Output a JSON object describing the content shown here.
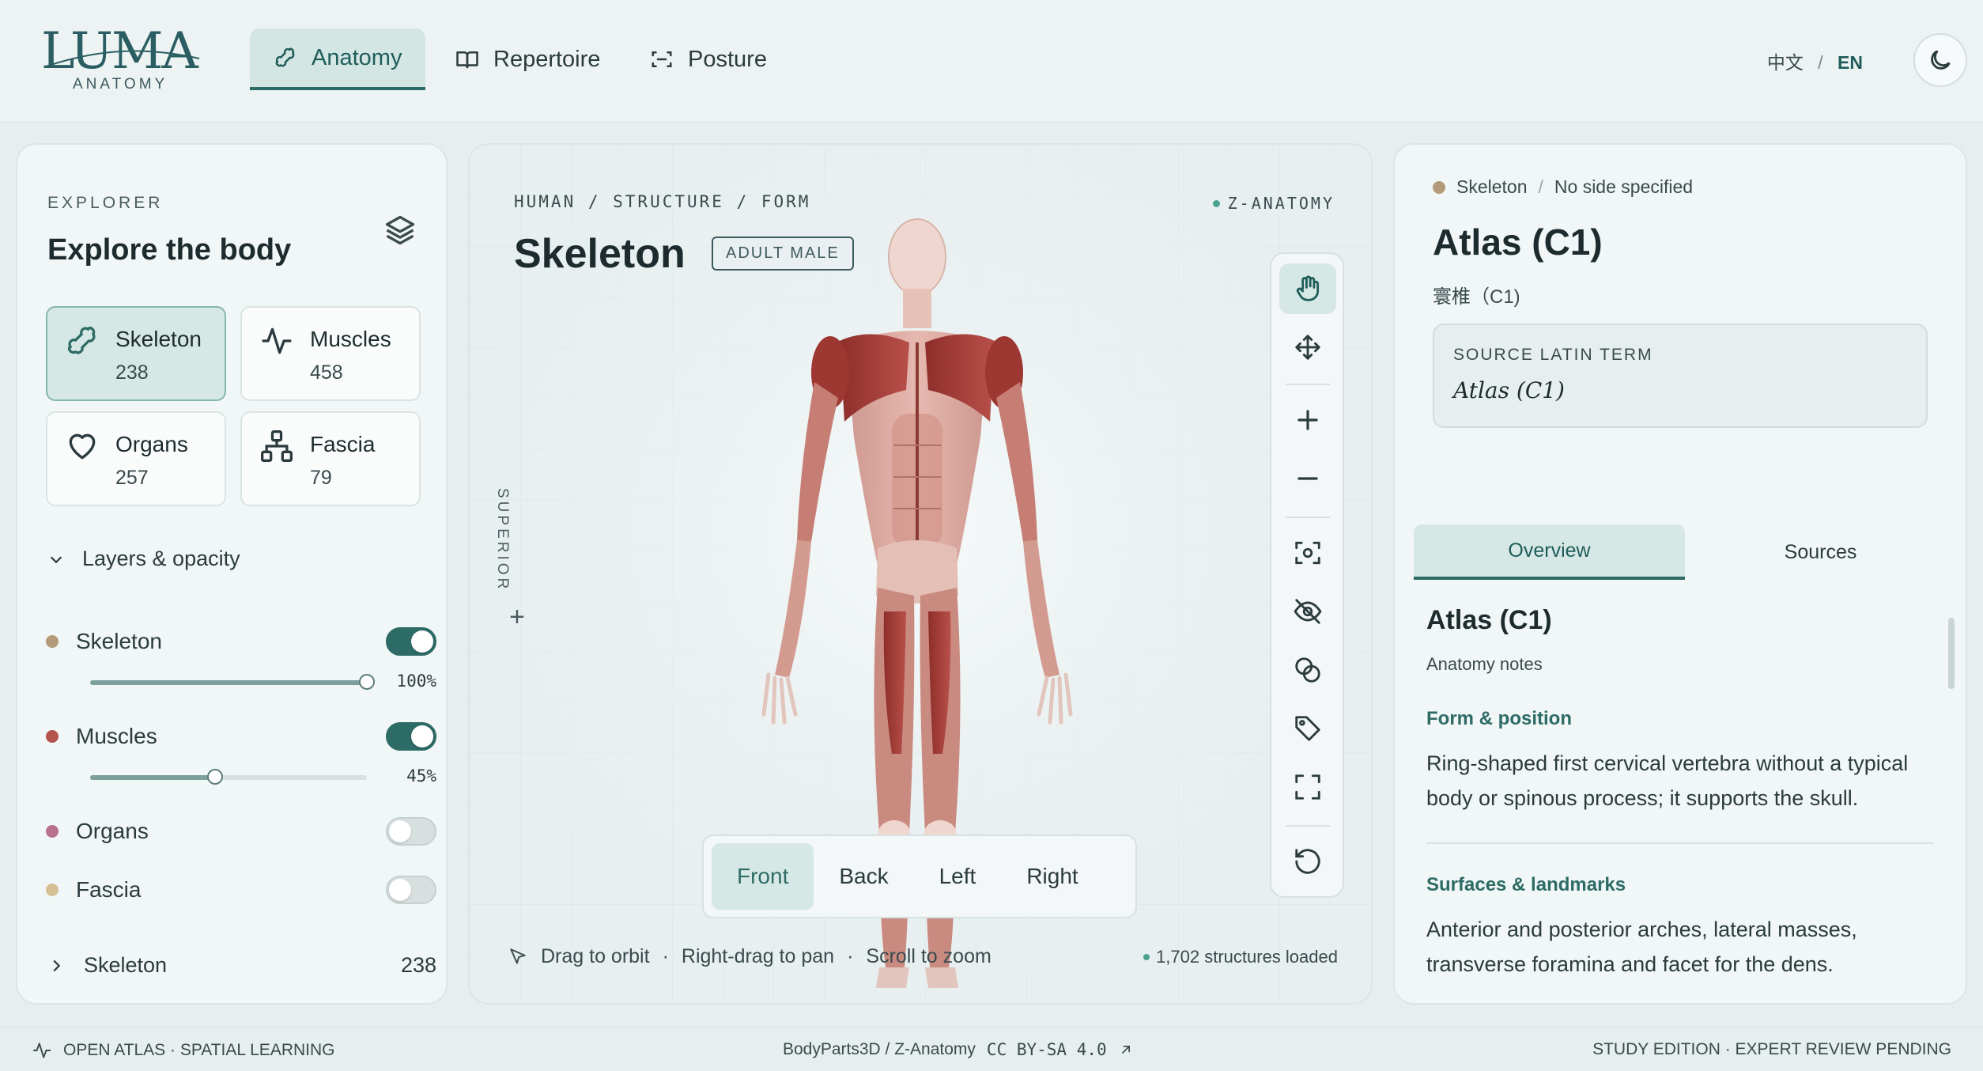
{
  "brand": {
    "wordmark": "LUMA",
    "sub": "ANATOMY"
  },
  "nav": {
    "tabs": [
      {
        "label": "Anatomy",
        "icon": "bone-icon",
        "active": true
      },
      {
        "label": "Repertoire",
        "icon": "book-icon",
        "active": false
      },
      {
        "label": "Posture",
        "icon": "scan-icon",
        "active": false
      }
    ],
    "lang_zh": "中文",
    "lang_sep": "/",
    "lang_en": "EN",
    "theme_icon": "moon-icon"
  },
  "explorer": {
    "eyebrow": "EXPLORER",
    "title": "Explore the body",
    "categories": [
      {
        "name": "Skeleton",
        "count": "238",
        "icon": "bone-icon",
        "active": true
      },
      {
        "name": "Muscles",
        "count": "458",
        "icon": "pulse-icon",
        "active": false
      },
      {
        "name": "Organs",
        "count": "257",
        "icon": "heart-icon",
        "active": false
      },
      {
        "name": "Fascia",
        "count": "79",
        "icon": "network-icon",
        "active": false
      }
    ],
    "layers_label": "Layers & opacity",
    "layers": [
      {
        "name": "Skeleton",
        "color": "#b39a79",
        "on": true,
        "opacity": 100,
        "opacity_label": "100%"
      },
      {
        "name": "Muscles",
        "color": "#b4524e",
        "on": true,
        "opacity": 45,
        "opacity_label": "45%"
      },
      {
        "name": "Organs",
        "color": "#b8708e",
        "on": false
      },
      {
        "name": "Fascia",
        "color": "#d4c094",
        "on": false
      }
    ],
    "group": {
      "name": "Skeleton",
      "count": "238"
    }
  },
  "viewer": {
    "breadcrumb": "HUMAN / STRUCTURE / FORM",
    "source": "Z-ANATOMY",
    "title": "Skeleton",
    "badge": "ADULT MALE",
    "axis_label": "SUPERIOR",
    "axis_plus": "+",
    "views": [
      "Front",
      "Back",
      "Left",
      "Right"
    ],
    "active_view": "Front",
    "hint_drag": "Drag to orbit",
    "hint_pan": "Right-drag to pan",
    "hint_zoom": "Scroll to zoom",
    "hint_sep": "·",
    "loaded": "1,702 structures loaded",
    "tools": [
      "hand-icon",
      "move-icon",
      "zoom-in-icon",
      "zoom-out-icon",
      "focus-icon",
      "hide-icon",
      "isolate-icon",
      "tag-icon",
      "fullscreen-icon",
      "reset-icon"
    ]
  },
  "detail": {
    "crumb_system": "Skeleton",
    "crumb_side": "No side specified",
    "title": "Atlas (C1)",
    "subtitle": "寰椎（C1)",
    "latin_label": "SOURCE LATIN TERM",
    "latin_value": "Atlas (C1)",
    "tabs": [
      "Overview",
      "Sources"
    ],
    "overview": {
      "title": "Atlas (C1)",
      "sub": "Anatomy notes",
      "form_head": "Form & position",
      "form_body": "Ring-shaped first cervical vertebra without a typical body or spinous process; it supports the skull.",
      "surf_head": "Surfaces & landmarks",
      "surf_body": "Anterior and posterior arches, lateral masses, transverse foramina and facet for the dens."
    }
  },
  "footer": {
    "left": "OPEN ATLAS · SPATIAL LEARNING",
    "mid_source": "BodyParts3D / Z-Anatomy",
    "mid_license": "CC BY-SA 4.0",
    "right": "STUDY EDITION · EXPERT REVIEW PENDING"
  }
}
